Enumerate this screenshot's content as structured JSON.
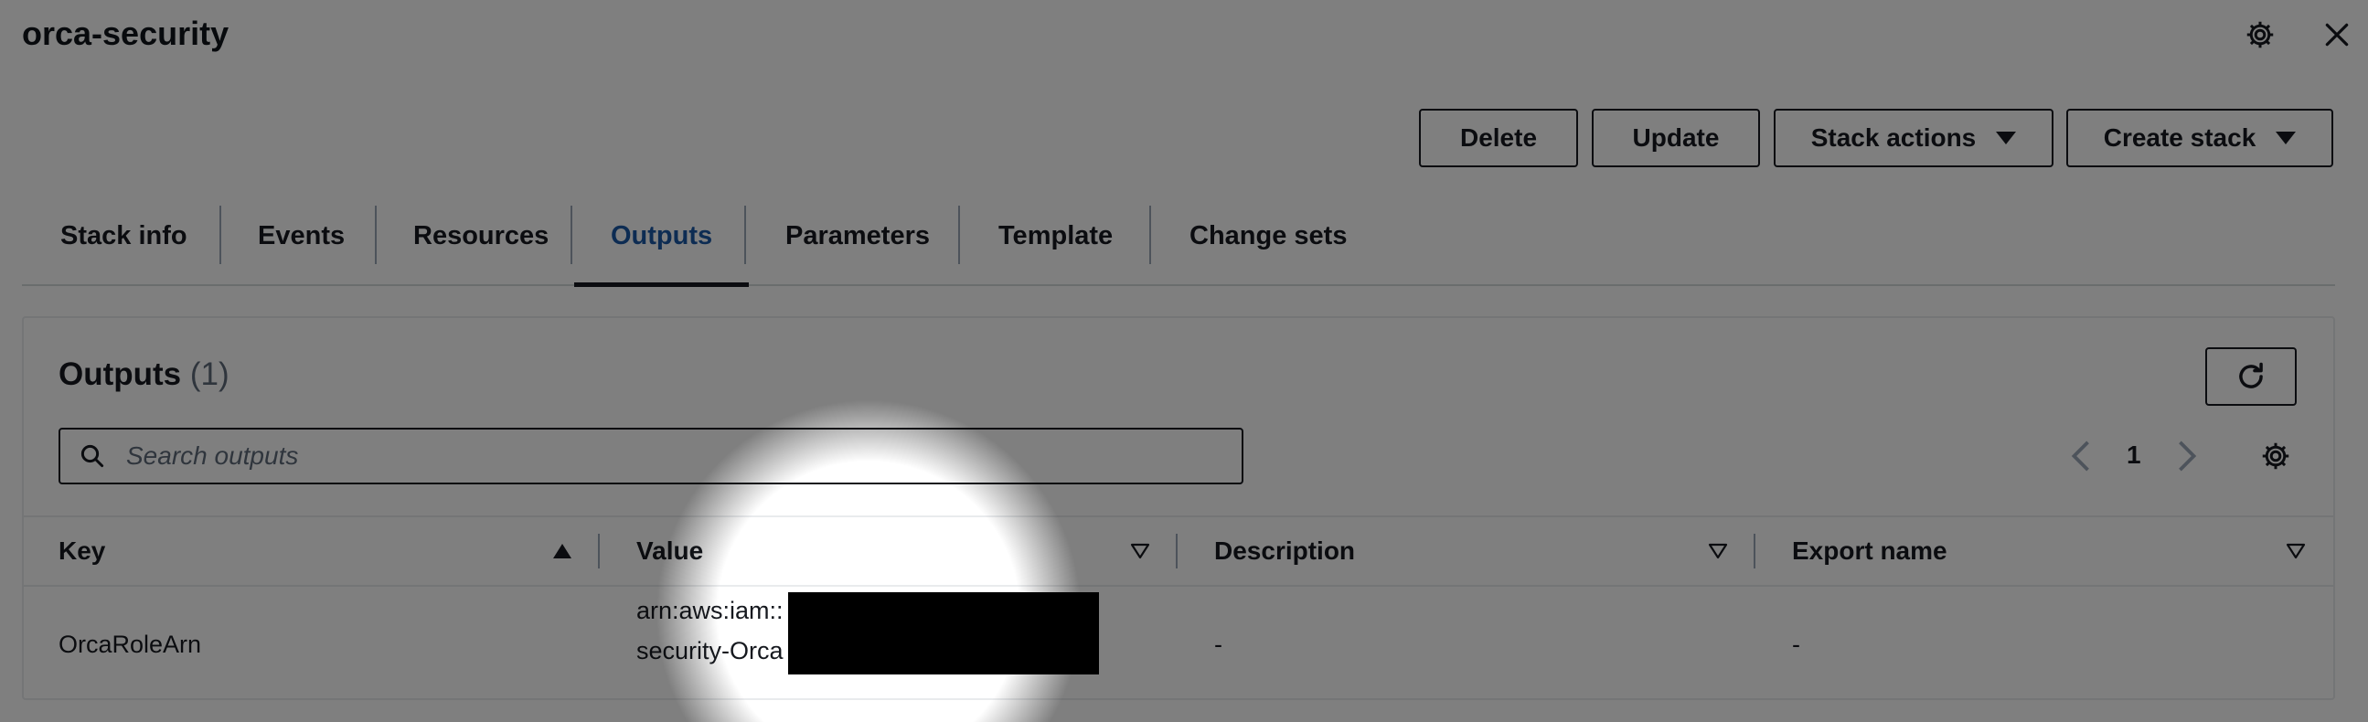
{
  "stack": {
    "name": "orca-security"
  },
  "header_icons": {
    "settings": "gear-icon",
    "close": "close-icon"
  },
  "actions": {
    "delete": "Delete",
    "update": "Update",
    "stack_actions": "Stack actions",
    "create_stack": "Create stack"
  },
  "tabs": [
    {
      "label": "Stack info",
      "active": false
    },
    {
      "label": "Events",
      "active": false
    },
    {
      "label": "Resources",
      "active": false
    },
    {
      "label": "Outputs",
      "active": true
    },
    {
      "label": "Parameters",
      "active": false
    },
    {
      "label": "Template",
      "active": false
    },
    {
      "label": "Change sets",
      "active": false
    }
  ],
  "outputs": {
    "title": "Outputs",
    "count": "(1)",
    "search_placeholder": "Search outputs",
    "page": "1",
    "columns": [
      "Key",
      "Value",
      "Description",
      "Export name"
    ],
    "sorted_column": "Key",
    "rows": [
      {
        "key": "OrcaRoleArn",
        "value_line1": "arn:aws:iam::",
        "value_line2": "security-Orca",
        "value_redacted": true,
        "description": "-",
        "export_name": "-"
      }
    ]
  },
  "colors": {
    "active_tab": "#1a59a6",
    "text": "#16191f",
    "overlay": "rgba(0,0,0,0.5)"
  }
}
